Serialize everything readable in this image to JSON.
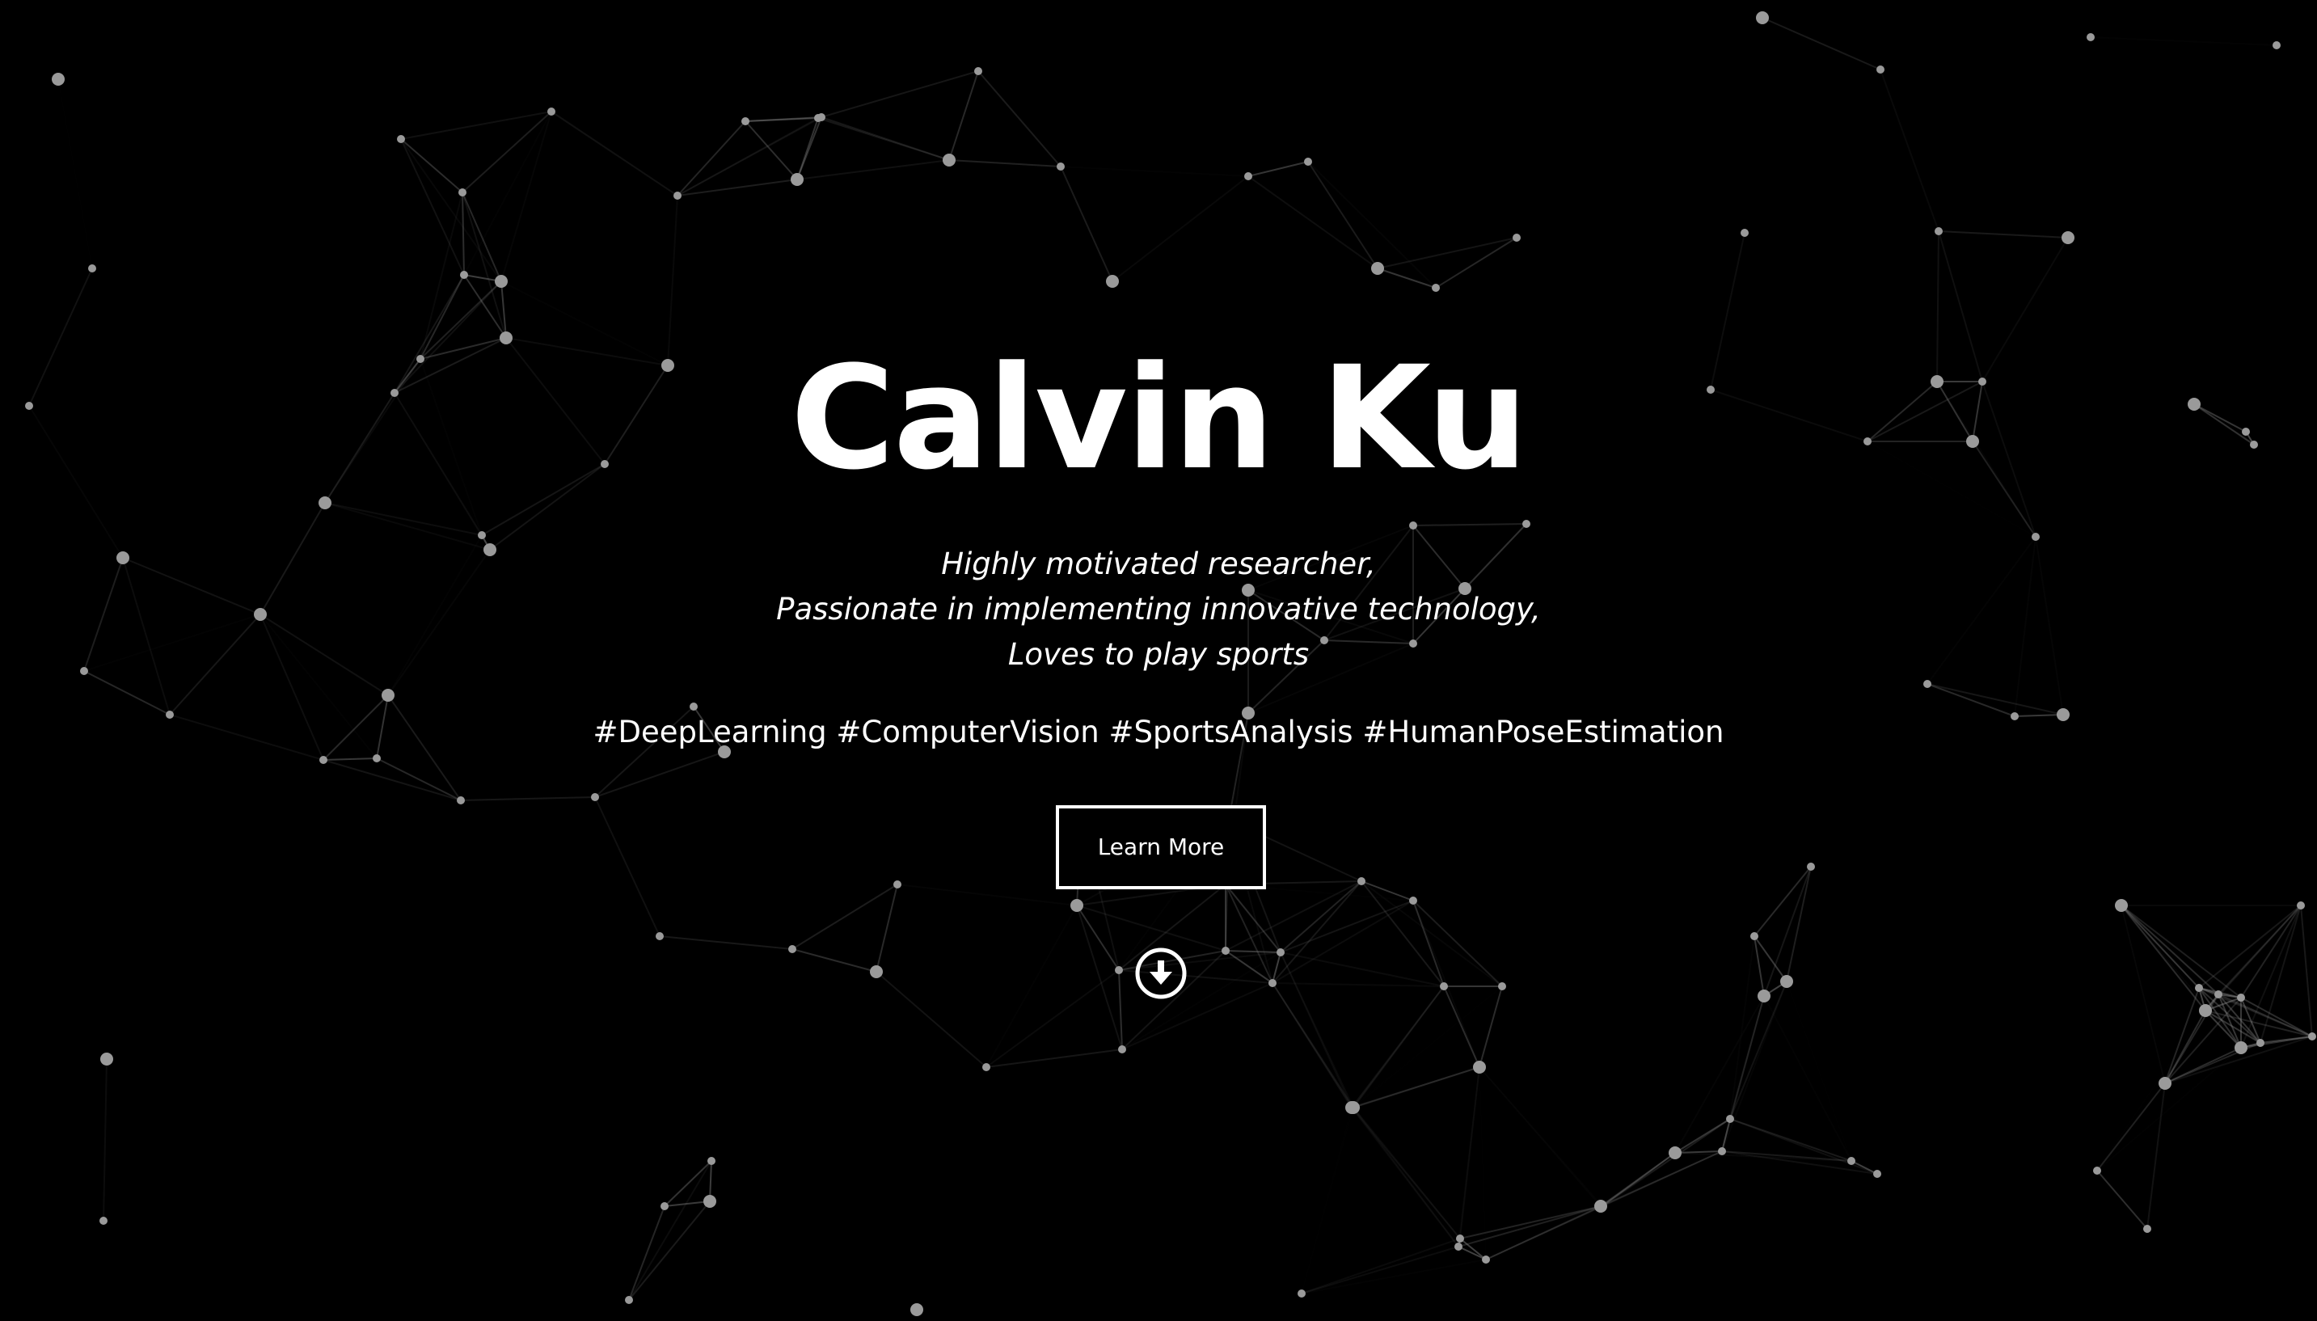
{
  "hero": {
    "title": "Calvin Ku",
    "tagline": [
      "Highly motivated researcher,",
      "Passionate in implementing innovative technology,",
      "Loves to play sports"
    ],
    "hashtags": "#DeepLearning #ComputerVision #SportsAnalysis #HumanPoseEstimation",
    "cta_label": "Learn More",
    "scroll_icon": "arrow-down-circle-icon"
  },
  "colors": {
    "background": "#000000",
    "text": "#ffffff",
    "node": "#9a9a9a",
    "link": "#8a8a8a"
  }
}
